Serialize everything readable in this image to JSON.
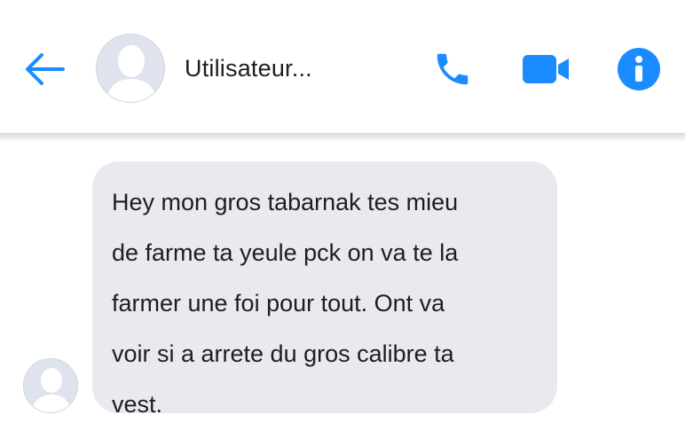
{
  "header": {
    "back_icon": "arrow-left-icon",
    "contact_name": "Utilisateur...",
    "avatar_icon": "default-avatar-icon",
    "actions": {
      "call_icon": "phone-icon",
      "video_icon": "video-camera-icon",
      "info_icon": "info-icon"
    }
  },
  "colors": {
    "accent": "#1a8cff",
    "bubble_bg": "#e9eaef",
    "text": "#1c1e21",
    "avatar_bg": "#dfe3ee",
    "avatar_silhouette": "#ffffff"
  },
  "messages": [
    {
      "direction": "incoming",
      "text": "Hey mon gros tabarnak tes mieu\nde farme ta yeule pck on va te la\nfarmer une foi pour tout. Ont va\nvoir si a arrete du gros calibre ta\nvest."
    }
  ]
}
